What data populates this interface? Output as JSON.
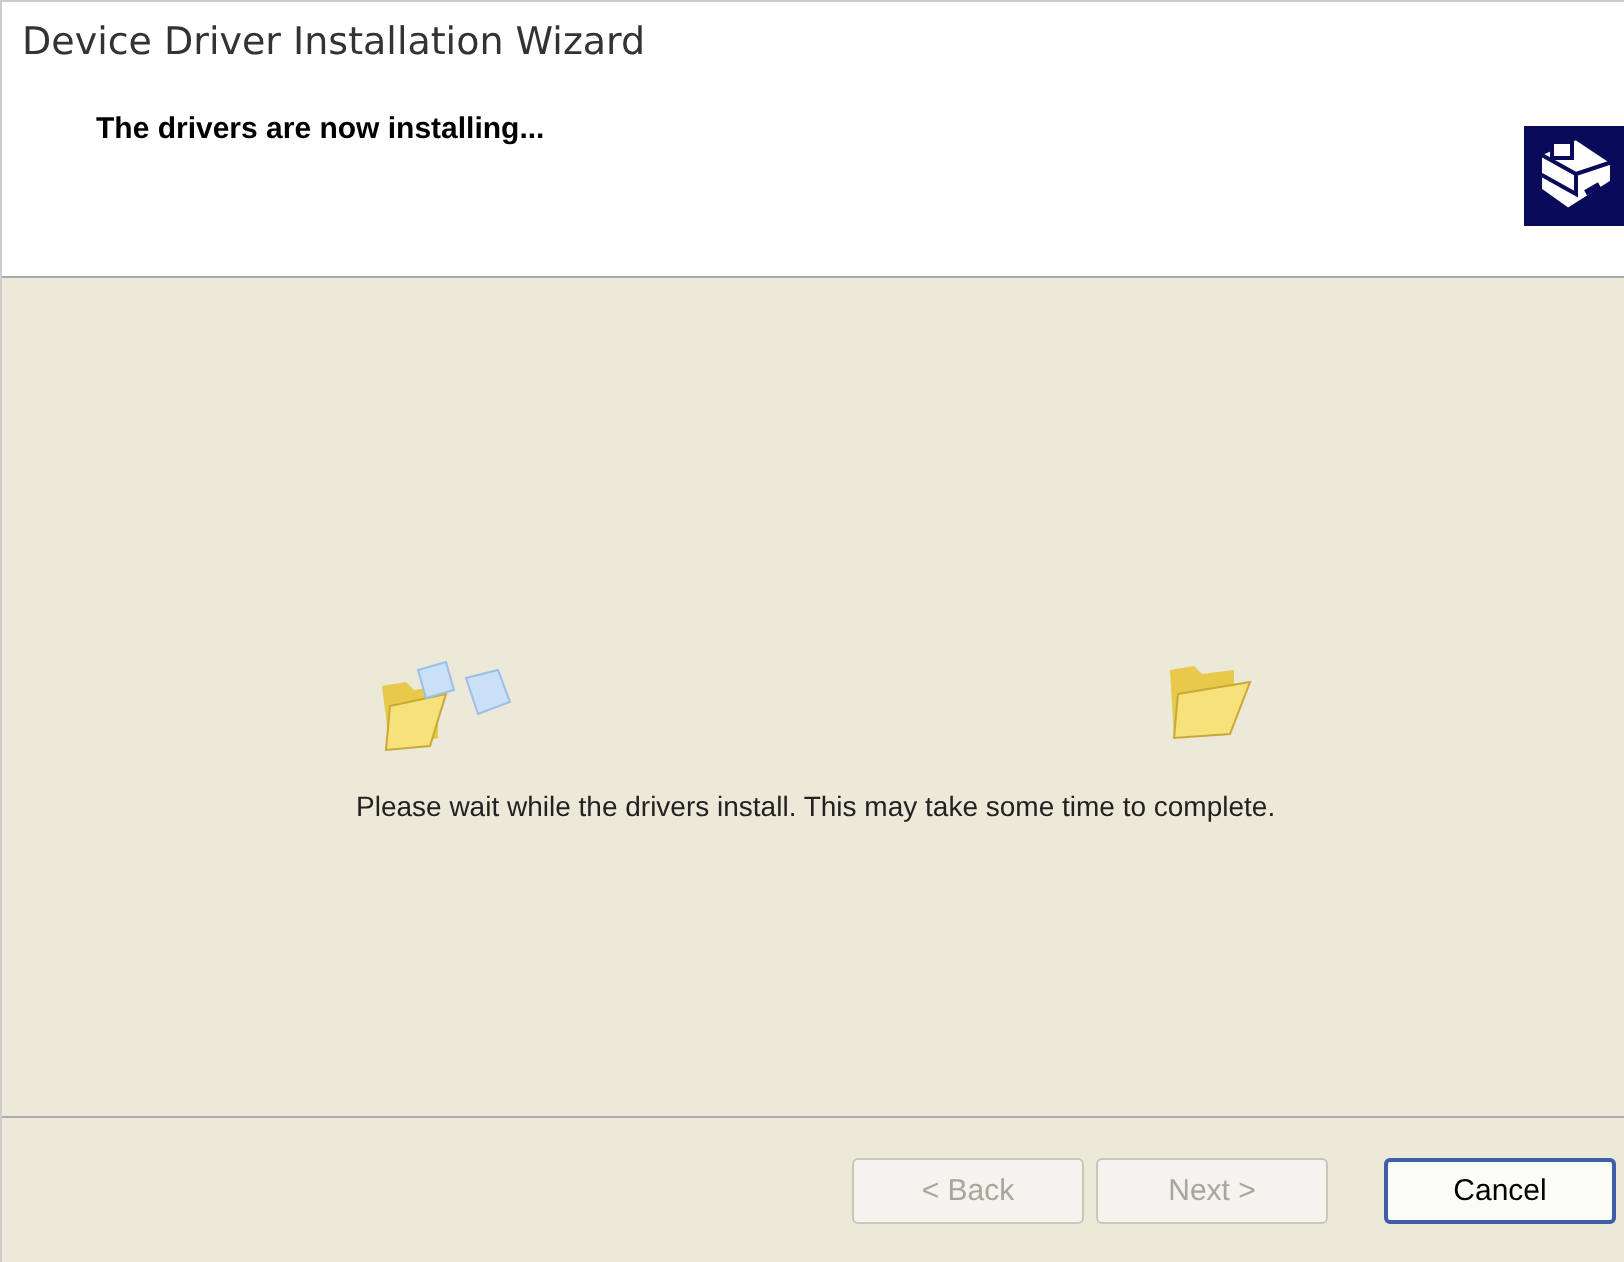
{
  "window": {
    "title": "Device Driver Installation Wizard"
  },
  "header": {
    "title": "The drivers are now installing..."
  },
  "body": {
    "message": "Please wait while the drivers install. This may take some time to complete."
  },
  "buttons": [
    {
      "label": "< Back",
      "disabled": true,
      "default": false
    },
    {
      "label": "Next >",
      "disabled": true,
      "default": false
    },
    {
      "label": "Cancel",
      "disabled": false,
      "default": true
    }
  ]
}
